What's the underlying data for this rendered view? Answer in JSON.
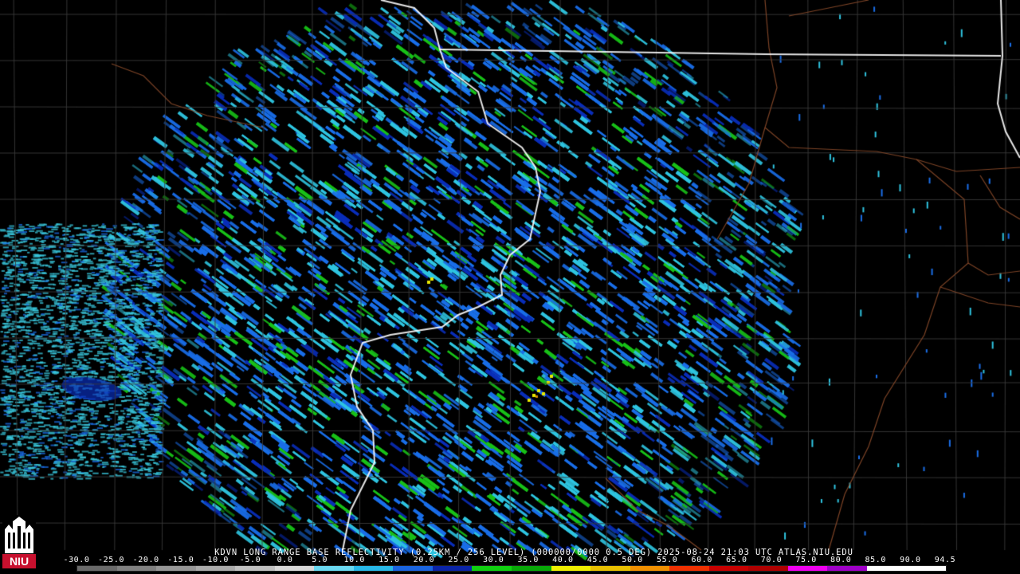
{
  "caption": {
    "station_product": "KDVN LONG RANGE BASE REFLECTIVITY (0.25KM / 256 LEVEL) (000000/0000 0.5 DEG)",
    "timestamp": "2025-08-24 21:03 UTC",
    "source": "ATLAS.NIU.EDU"
  },
  "logo": {
    "text": "NIU",
    "icon": "niu-tower-logo-icon"
  },
  "legend": {
    "ticks": [
      "-30.0",
      "-25.0",
      "-20.0",
      "-15.0",
      "-10.0",
      "-5.0",
      "0.0",
      "5.0",
      "10.0",
      "15.0",
      "20.0",
      "25.0",
      "30.0",
      "35.0",
      "40.0",
      "45.0",
      "50.0",
      "55.0",
      "60.0",
      "65.0",
      "70.0",
      "75.0",
      "80.0",
      "85.0",
      "90.0",
      "94.5"
    ],
    "colors": [
      "#6a6a6a",
      "#808080",
      "#969696",
      "#aaaaaa",
      "#c0c0c0",
      "#d8d8d8",
      "#6ad8f0",
      "#28b8e8",
      "#1a64e0",
      "#0a24a8",
      "#10d010",
      "#08a808",
      "#f0f000",
      "#e8c000",
      "#f09000",
      "#f03000",
      "#c80000",
      "#b00000",
      "#f000f0",
      "#a000c8",
      "#ffffff",
      "#ffffff"
    ]
  },
  "colors": {
    "background": "#000000",
    "county_lines": "#3a3a3a",
    "state_lines": "#ffffff",
    "rivers": "#8a4a2a",
    "radar_light": "#2fc4e0",
    "radar_mid": "#1a6ee8",
    "radar_dark": "#0a2eb8",
    "radar_green": "#18c018",
    "radar_yellow": "#e8e800"
  },
  "radar_site": "kdvn-site-marker"
}
